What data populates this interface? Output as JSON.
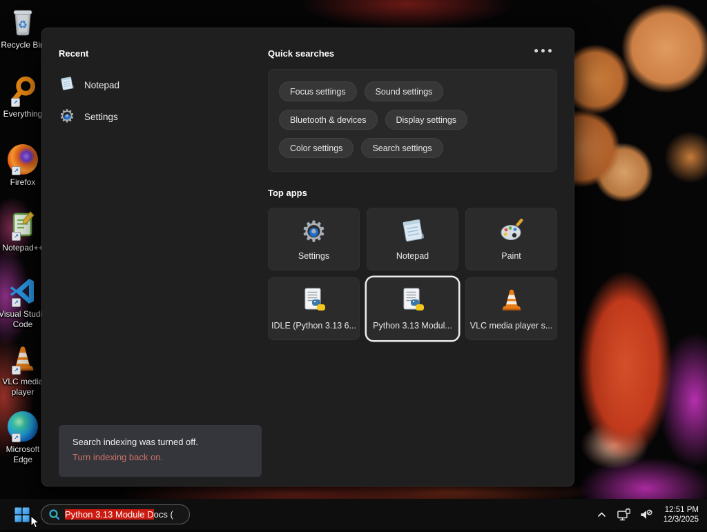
{
  "colors": {
    "panel_bg": "#1f1f1f",
    "card_bg": "#282828",
    "pill_bg": "#373737",
    "tile_bg": "#2b2b2b",
    "selected_tile_border": "#ececec",
    "selection_red": "#cc1a10",
    "notice_action": "#cd7266",
    "accent_blue": "#1f6fd0",
    "taskbar_bg": "#0e0e0e"
  },
  "desktop": {
    "icons": [
      {
        "icon": "recycle-bin-icon",
        "label": "Recycle Bin"
      },
      {
        "icon": "everything-icon",
        "label": "Everything"
      },
      {
        "icon": "firefox-icon",
        "label": "Firefox"
      },
      {
        "icon": "notepad-plus-plus-icon",
        "label": "Notepad++"
      },
      {
        "icon": "visual-studio-code-icon",
        "label": "Visual Studio Code"
      },
      {
        "icon": "vlc-icon",
        "label": "VLC media player"
      },
      {
        "icon": "microsoft-edge-icon",
        "label": "Microsoft Edge"
      }
    ]
  },
  "search_panel": {
    "recent": {
      "title": "Recent",
      "items": [
        {
          "icon": "notepad-icon",
          "label": "Notepad"
        },
        {
          "icon": "settings-gear-icon",
          "label": "Settings"
        }
      ]
    },
    "quick_searches": {
      "title": "Quick searches",
      "more_label": "•••",
      "pills": [
        "Focus settings",
        "Sound settings",
        "Bluetooth & devices",
        "Display settings",
        "Color settings",
        "Search settings"
      ]
    },
    "top_apps": {
      "title": "Top apps",
      "tiles": [
        {
          "icon": "settings-gear-icon",
          "label": "Settings",
          "selected": false
        },
        {
          "icon": "notepad-icon",
          "label": "Notepad",
          "selected": false
        },
        {
          "icon": "paint-icon",
          "label": "Paint",
          "selected": false
        },
        {
          "icon": "python-doc-icon",
          "label": "IDLE (Python 3.13 6...",
          "selected": false
        },
        {
          "icon": "python-doc-icon",
          "label": "Python 3.13 Modul...",
          "selected": true
        },
        {
          "icon": "vlc-icon",
          "label": "VLC media player s...",
          "selected": false
        }
      ]
    },
    "indexing_notice": {
      "message": "Search indexing was turned off.",
      "action": "Turn indexing back on."
    }
  },
  "taskbar": {
    "search": {
      "icon": "search-icon",
      "selected_text": "Python 3.13 Module D",
      "rest_text": "ocs ("
    },
    "tray": {
      "chevron_icon": "hidden-icons-chevron",
      "network_icon": "network-icon",
      "volume_icon": "volume-mute-icon",
      "time": "12:51 PM",
      "date": "12/3/2025"
    }
  }
}
